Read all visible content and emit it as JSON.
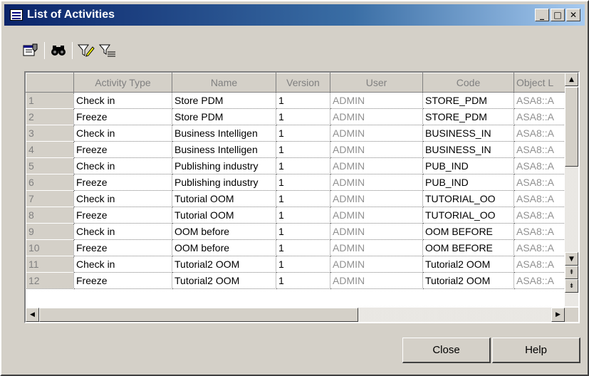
{
  "window": {
    "title": "List of Activities",
    "buttons": {
      "minimize": "_",
      "maximize": "□",
      "close": "✕"
    }
  },
  "toolbar": {
    "icons": [
      "properties-icon",
      "find-icon",
      "filter-edit-icon",
      "filter-icon"
    ]
  },
  "grid": {
    "columns": [
      "Activity Type",
      "Name",
      "Version",
      "User",
      "Code",
      "Object L"
    ],
    "rows": [
      {
        "num": "1",
        "type": "Check in",
        "name": "Store PDM",
        "version": "1",
        "user": "ADMIN",
        "code": "STORE_PDM",
        "object": "ASA8::A"
      },
      {
        "num": "2",
        "type": "Freeze",
        "name": "Store PDM",
        "version": "1",
        "user": "ADMIN",
        "code": "STORE_PDM",
        "object": "ASA8::A"
      },
      {
        "num": "3",
        "type": "Check in",
        "name": "Business Intelligen",
        "version": "1",
        "user": "ADMIN",
        "code": "BUSINESS_IN",
        "object": "ASA8::A"
      },
      {
        "num": "4",
        "type": "Freeze",
        "name": "Business Intelligen",
        "version": "1",
        "user": "ADMIN",
        "code": "BUSINESS_IN",
        "object": "ASA8::A"
      },
      {
        "num": "5",
        "type": "Check in",
        "name": "Publishing industry",
        "version": "1",
        "user": "ADMIN",
        "code": "PUB_IND",
        "object": "ASA8::A"
      },
      {
        "num": "6",
        "type": "Freeze",
        "name": "Publishing industry",
        "version": "1",
        "user": "ADMIN",
        "code": "PUB_IND",
        "object": "ASA8::A"
      },
      {
        "num": "7",
        "type": "Check in",
        "name": "Tutorial OOM",
        "version": "1",
        "user": "ADMIN",
        "code": "TUTORIAL_OO",
        "object": "ASA8::A"
      },
      {
        "num": "8",
        "type": "Freeze",
        "name": "Tutorial OOM",
        "version": "1",
        "user": "ADMIN",
        "code": "TUTORIAL_OO",
        "object": "ASA8::A"
      },
      {
        "num": "9",
        "type": "Check in",
        "name": "OOM before",
        "version": "1",
        "user": "ADMIN",
        "code": "OOM BEFORE",
        "object": "ASA8::A"
      },
      {
        "num": "10",
        "type": "Freeze",
        "name": "OOM before",
        "version": "1",
        "user": "ADMIN",
        "code": "OOM BEFORE",
        "object": "ASA8::A"
      },
      {
        "num": "11",
        "type": "Check in",
        "name": "Tutorial2 OOM",
        "version": "1",
        "user": "ADMIN",
        "code": "Tutorial2 OOM",
        "object": "ASA8::A"
      },
      {
        "num": "12",
        "type": "Freeze",
        "name": "Tutorial2 OOM",
        "version": "1",
        "user": "ADMIN",
        "code": "Tutorial2 OOM",
        "object": "ASA8::A"
      }
    ]
  },
  "buttons": {
    "close": "Close",
    "help": "Help"
  }
}
